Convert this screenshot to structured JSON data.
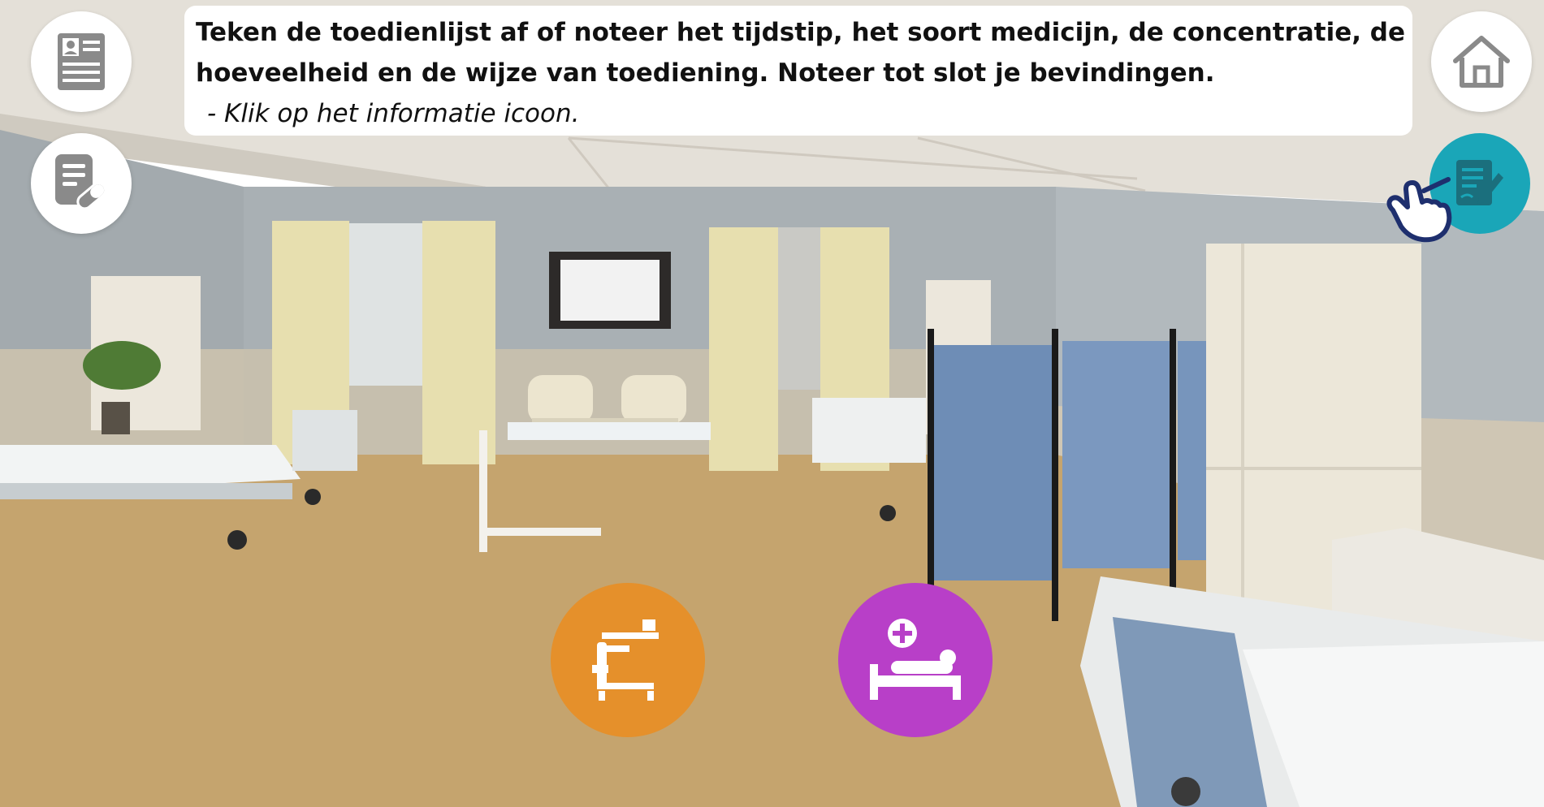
{
  "instruction": {
    "line1": "Teken de toedienlijst af of noteer het tijdstip, het soort medicijn, de concentratie, de",
    "line2": "hoeveelheid en de wijze van toediening. Noteer tot slot je bevindingen.",
    "hint": "- Klik op het informatie icoon."
  },
  "buttons": {
    "patient_file": "patient-file-icon",
    "medication_list": "medication-list-icon",
    "home": "home-icon",
    "notes": "notes-icon"
  },
  "hotspots": {
    "trolley": {
      "icon": "overbed-table-icon",
      "color": "#e5902b"
    },
    "patient": {
      "icon": "patient-bed-icon",
      "color": "#b83fc8"
    }
  },
  "colors": {
    "teal": "#1aa6b8",
    "hand": "#1e2f6e",
    "icon_gray": "#8a8a8a"
  }
}
